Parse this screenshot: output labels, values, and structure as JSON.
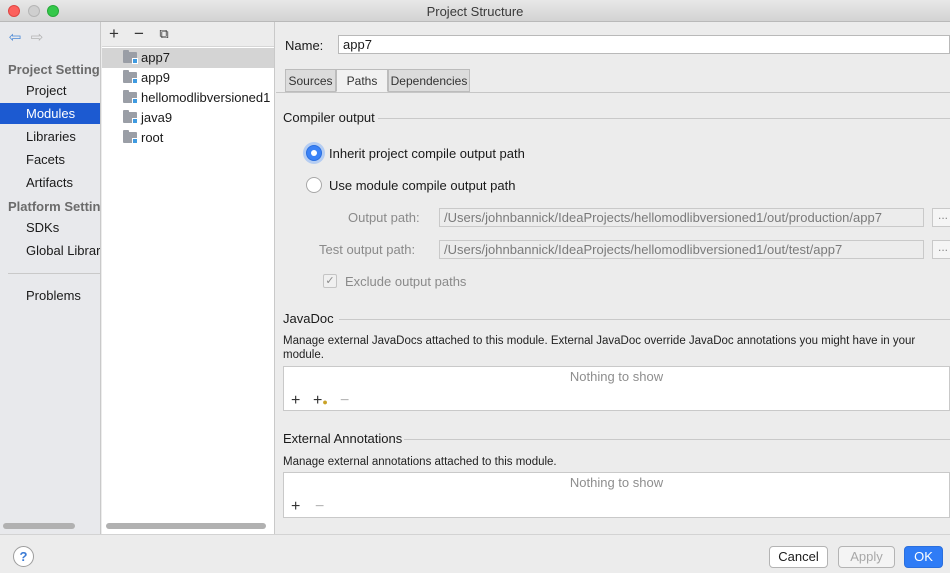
{
  "window": {
    "title": "Project Structure"
  },
  "nav": {
    "sections": [
      {
        "label": "Project Settings",
        "items": [
          "Project",
          "Modules",
          "Libraries",
          "Facets",
          "Artifacts"
        ]
      },
      {
        "label": "Platform Settings",
        "items": [
          "SDKs",
          "Global Libraries"
        ]
      }
    ],
    "problems_label": "Problems",
    "selected": "Modules"
  },
  "modules": {
    "items": [
      "app7",
      "app9",
      "hellomodlibversioned1",
      "java9",
      "root"
    ],
    "selected": "app7"
  },
  "editor": {
    "name_label": "Name:",
    "name_value": "app7",
    "tabs": [
      "Sources",
      "Paths",
      "Dependencies"
    ],
    "active_tab": "Paths",
    "compiler_output": {
      "heading": "Compiler output",
      "inherit_label": "Inherit project compile output path",
      "use_module_label": "Use module compile output path",
      "output_path_label": "Output path:",
      "output_path_value": "/Users/johnbannick/IdeaProjects/hellomodlibversioned1/out/production/app7",
      "test_output_path_label": "Test output path:",
      "test_output_path_value": "/Users/johnbannick/IdeaProjects/hellomodlibversioned1/out/test/app7",
      "browse_label": "...",
      "exclude_label": "Exclude output paths"
    },
    "javadoc": {
      "heading": "JavaDoc",
      "description": "Manage external JavaDocs attached to this module. External JavaDoc override JavaDoc annotations you might have in your module.",
      "empty_text": "Nothing to show"
    },
    "external_annotations": {
      "heading": "External Annotations",
      "description": "Manage external annotations attached to this module.",
      "empty_text": "Nothing to show"
    }
  },
  "footer": {
    "help_label": "?",
    "cancel_label": "Cancel",
    "apply_label": "Apply",
    "ok_label": "OK"
  },
  "colors": {
    "selection_blue": "#1c5ad1",
    "primary_button": "#2f7cf6"
  }
}
